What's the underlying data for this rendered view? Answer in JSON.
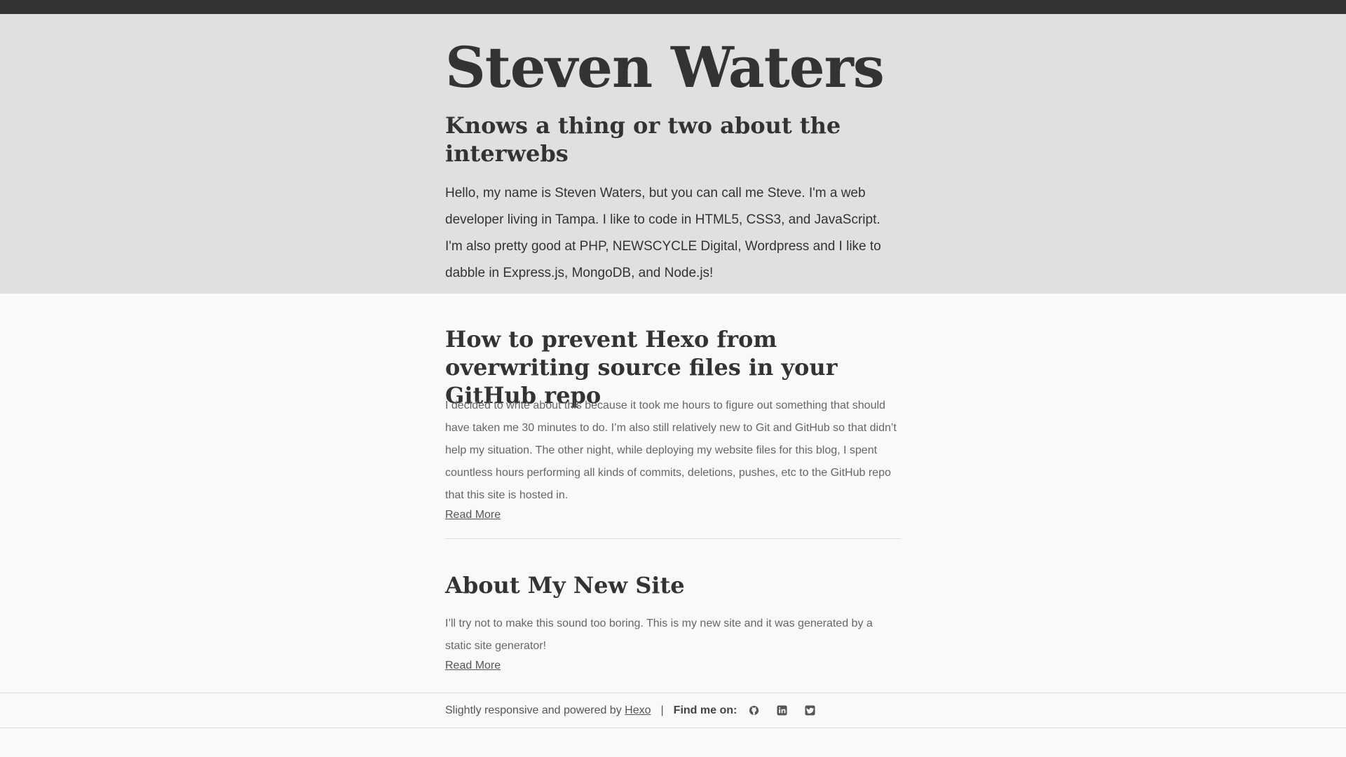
{
  "header": {
    "title": "Steven Waters",
    "tagline": "Knows a thing or two about the interwebs",
    "intro": "Hello, my name is Steven Waters, but you can call me Steve. I'm a web developer living in Tampa. I like to code in HTML5, CSS3, and JavaScript. I'm also pretty good at PHP, NEWSCYCLE Digital, Wordpress and I like to dabble in Express.js, MongoDB, and Node.js!"
  },
  "posts": [
    {
      "title": "How to prevent Hexo from overwriting source files in your GitHub repo",
      "excerpt": "I decided to write about this because it took me hours to figure out something that should have taken me 30 minutes to do. I’m also still relatively new to Git and GitHub so that didn’t help my situation. The other night, while deploying my website files for this blog, I spent countless hours performing all kinds of commits, deletions, pushes, etc to the GitHub repo that this site is hosted in.",
      "read_more": "Read More"
    },
    {
      "title": "About My New Site",
      "excerpt": "I’ll try not to make this sound too boring. This is my new site and it was generated by a static site generator!",
      "read_more": "Read More"
    }
  ],
  "footer": {
    "powered_text": "Slightly responsive and powered by",
    "hexo_link": "Hexo",
    "separator": "|",
    "find_me": "Find me on:",
    "social_icons": [
      "github-icon",
      "linkedin-icon",
      "twitter-icon"
    ]
  },
  "colors": {
    "topbar": "#333333",
    "hero_bg": "#e0e0e0",
    "page_bg": "#f9f9f9",
    "heading": "#333333",
    "body_text": "#666666"
  }
}
